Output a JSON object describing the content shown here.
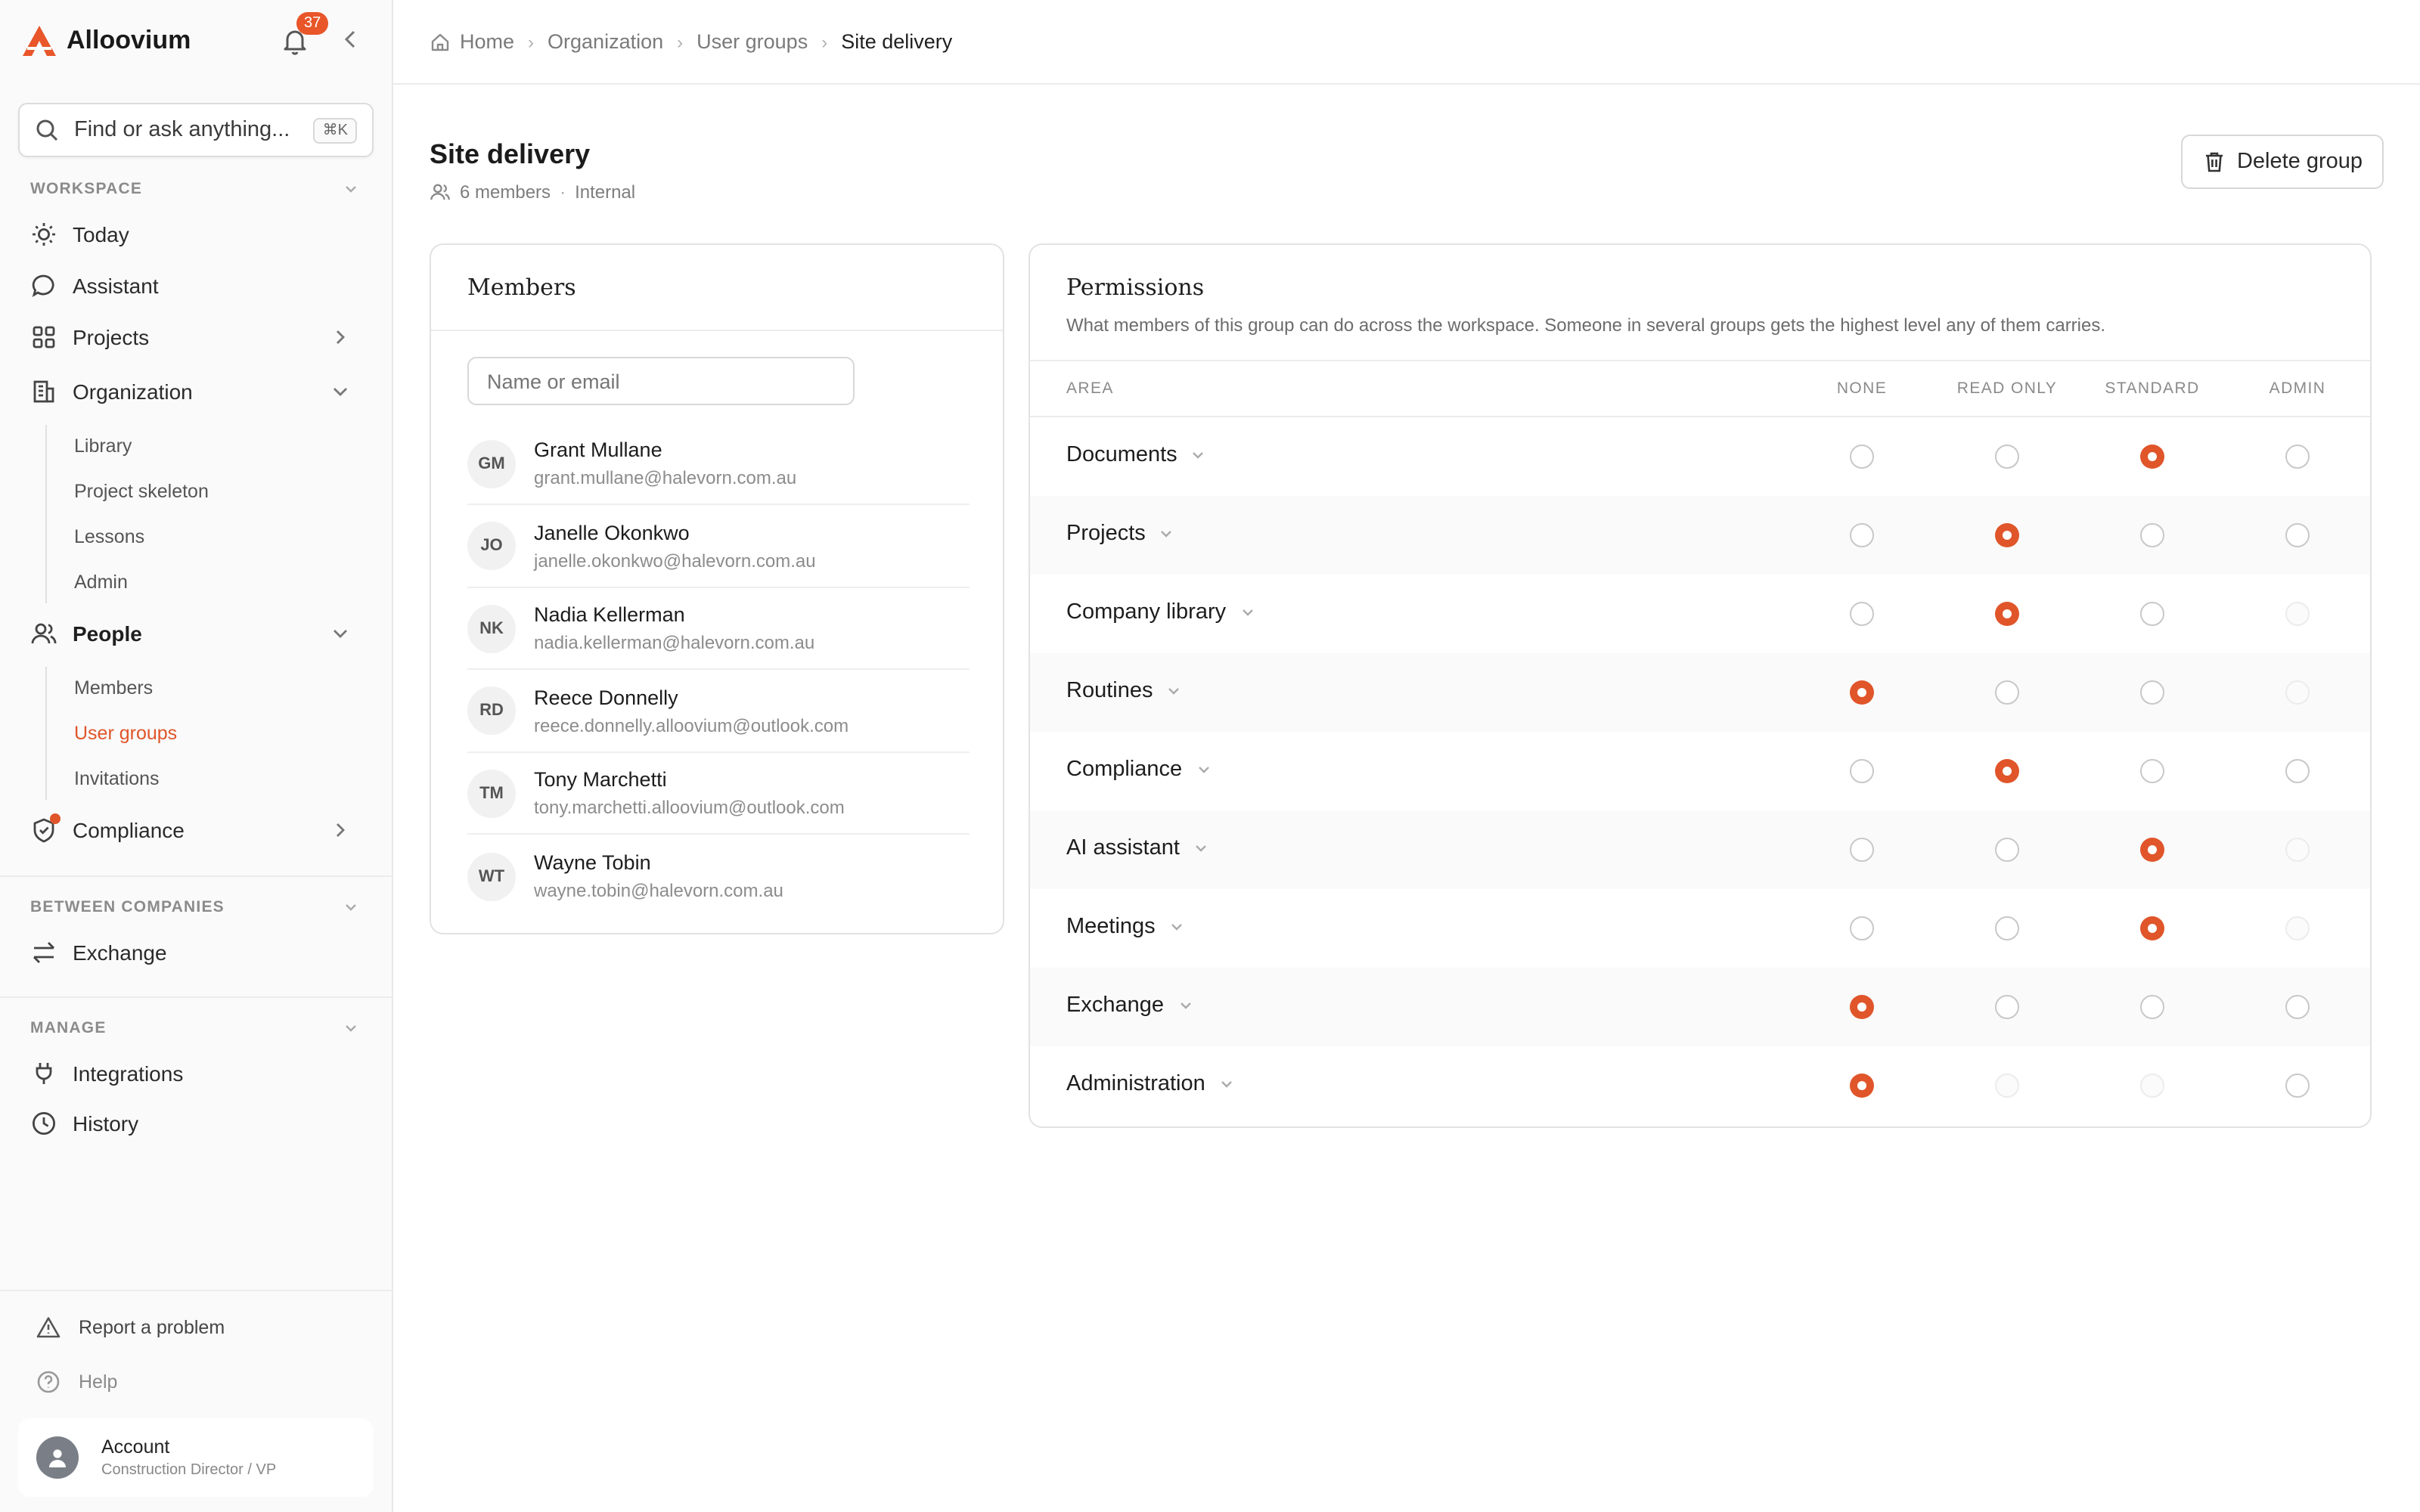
{
  "app": {
    "name": "Alloovium",
    "notification_count": "37"
  },
  "search": {
    "placeholder": "Find or ask anything...",
    "shortcut": "⌘K"
  },
  "sidebar": {
    "workspace_label": "WORKSPACE",
    "today": "Today",
    "assistant": "Assistant",
    "projects": "Projects",
    "organization": "Organization",
    "org_sub": [
      "Library",
      "Project skeleton",
      "Lessons",
      "Admin"
    ],
    "people": "People",
    "people_sub": [
      "Members",
      "User groups",
      "Invitations"
    ],
    "compliance": "Compliance",
    "between_label": "BETWEEN COMPANIES",
    "exchange": "Exchange",
    "manage_label": "MANAGE",
    "integrations": "Integrations",
    "history": "History",
    "report": "Report a problem",
    "help": "Help",
    "account_name": "Account",
    "account_role": "Construction Director / VP"
  },
  "breadcrumb": [
    "Home",
    "Organization",
    "User groups",
    "Site delivery"
  ],
  "page": {
    "title": "Site delivery",
    "members_count": "6 members",
    "visibility": "Internal",
    "delete_label": "Delete group"
  },
  "members_card": {
    "title": "Members",
    "filter_placeholder": "Name or email",
    "members": [
      {
        "initials": "GM",
        "name": "Grant Mullane",
        "email": "grant.mullane@halevorn.com.au"
      },
      {
        "initials": "JO",
        "name": "Janelle Okonkwo",
        "email": "janelle.okonkwo@halevorn.com.au"
      },
      {
        "initials": "NK",
        "name": "Nadia Kellerman",
        "email": "nadia.kellerman@halevorn.com.au"
      },
      {
        "initials": "RD",
        "name": "Reece Donnelly",
        "email": "reece.donnelly.alloovium@outlook.com"
      },
      {
        "initials": "TM",
        "name": "Tony Marchetti",
        "email": "tony.marchetti.alloovium@outlook.com"
      },
      {
        "initials": "WT",
        "name": "Wayne Tobin",
        "email": "wayne.tobin@halevorn.com.au"
      }
    ]
  },
  "permissions": {
    "title": "Permissions",
    "description": "What members of this group can do across the workspace. Someone in several groups gets the highest level any of them carries.",
    "area_header": "AREA",
    "levels": [
      "NONE",
      "READ ONLY",
      "STANDARD",
      "ADMIN"
    ],
    "rows": [
      {
        "area": "Documents",
        "selected": 2,
        "disabled": []
      },
      {
        "area": "Projects",
        "selected": 1,
        "disabled": []
      },
      {
        "area": "Company library",
        "selected": 1,
        "disabled": [
          3
        ]
      },
      {
        "area": "Routines",
        "selected": 0,
        "disabled": [
          3
        ]
      },
      {
        "area": "Compliance",
        "selected": 1,
        "disabled": []
      },
      {
        "area": "AI assistant",
        "selected": 2,
        "disabled": [
          3
        ]
      },
      {
        "area": "Meetings",
        "selected": 2,
        "disabled": [
          3
        ]
      },
      {
        "area": "Exchange",
        "selected": 0,
        "disabled": []
      },
      {
        "area": "Administration",
        "selected": 0,
        "disabled": [
          1,
          2
        ]
      }
    ]
  },
  "colors": {
    "accent": "#e0552a",
    "badge": "#e8562a"
  }
}
